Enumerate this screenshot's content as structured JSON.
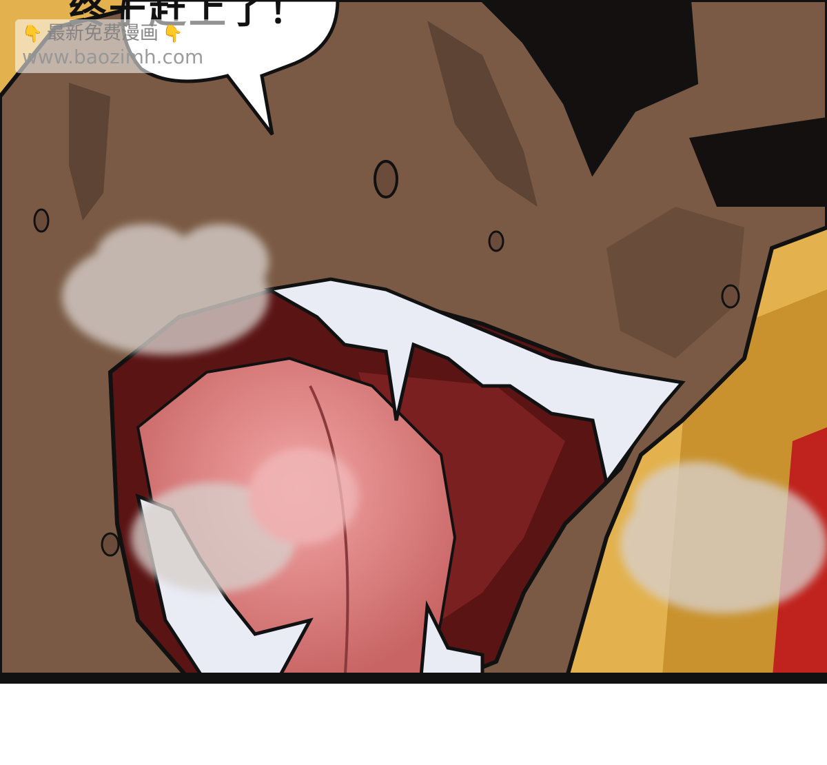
{
  "speech_bubble": {
    "text": "终于赶上了！"
  },
  "watermark": {
    "left_icon": "pointing-down-hand-icon",
    "label": "最新免费漫画",
    "right_icon": "pointing-down-hand-icon",
    "url": "www.baozimh.com"
  },
  "colors": {
    "skin": "#7a5a44",
    "skin_shadow": "#5e4434",
    "mouth_dark": "#5a1414",
    "tongue": "#e48f8f",
    "teeth": "#e9ebf5",
    "hair": "#e3b24e",
    "steam": "#d8d0cc",
    "ink": "#111111"
  }
}
